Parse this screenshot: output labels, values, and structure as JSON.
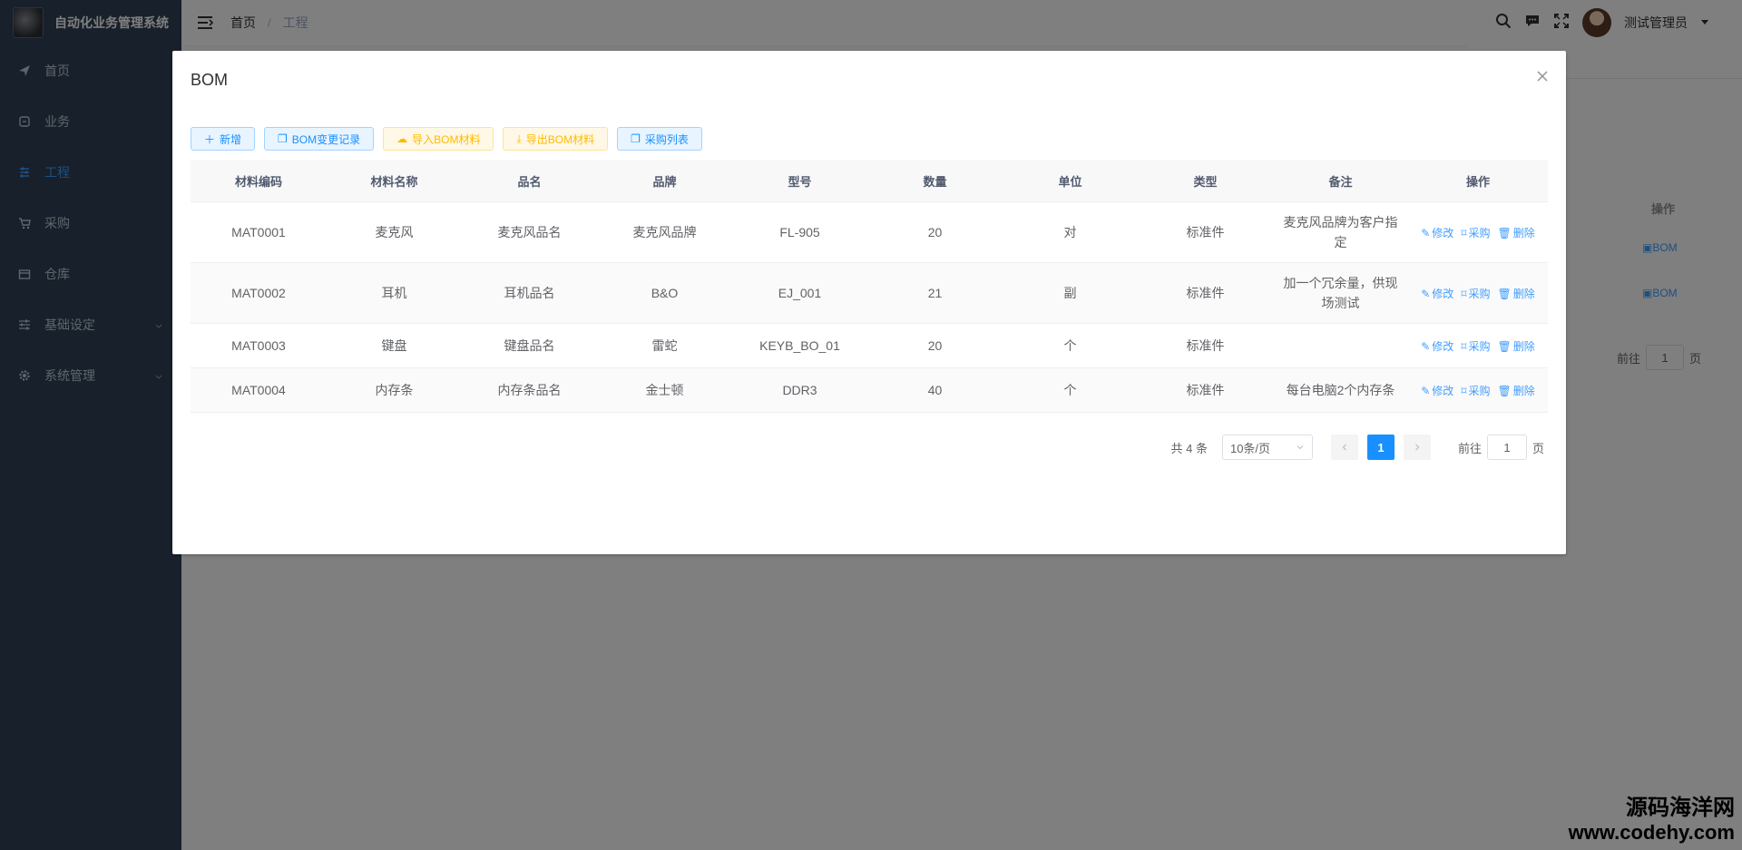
{
  "app": {
    "title": "自动化业务管理系统"
  },
  "sidebar": {
    "items": [
      {
        "label": "首页",
        "icon": "paper-plane-icon"
      },
      {
        "label": "业务",
        "icon": "business-icon"
      },
      {
        "label": "工程",
        "icon": "engineering-icon",
        "active": true
      },
      {
        "label": "采购",
        "icon": "cart-icon"
      },
      {
        "label": "仓库",
        "icon": "warehouse-icon"
      },
      {
        "label": "基础设定",
        "icon": "sliders-icon",
        "has_children": true
      },
      {
        "label": "系统管理",
        "icon": "gear-icon",
        "has_children": true
      }
    ]
  },
  "navbar": {
    "breadcrumb": [
      "首页",
      "工程"
    ],
    "user": {
      "name": "测试管理员"
    }
  },
  "background": {
    "table_header": "操作",
    "row_actions": [
      "BOM",
      "BOM"
    ],
    "pager": {
      "goto_label": "前往",
      "goto_value": "1",
      "page_suffix": "页"
    }
  },
  "dialog": {
    "title": "BOM",
    "toolbar": [
      {
        "label": "新增",
        "icon": "plus-icon",
        "style": "primary"
      },
      {
        "label": "BOM变更记录",
        "icon": "copy-icon",
        "style": "info"
      },
      {
        "label": "导入BOM材料",
        "icon": "upload-icon",
        "style": "warning"
      },
      {
        "label": "导出BOM材料",
        "icon": "download-icon",
        "style": "warning"
      },
      {
        "label": "采购列表",
        "icon": "copy-icon",
        "style": "blue-alt"
      }
    ],
    "table": {
      "columns": [
        "材料编码",
        "材料名称",
        "品名",
        "品牌",
        "型号",
        "数量",
        "单位",
        "类型",
        "备注",
        "操作"
      ],
      "rows": [
        {
          "code": "MAT0001",
          "name": "麦克风",
          "product": "麦克风品名",
          "brand": "麦克风品牌",
          "model": "FL-905",
          "qty": "20",
          "unit": "对",
          "type": "标准件",
          "note": "麦克风品牌为客户指定"
        },
        {
          "code": "MAT0002",
          "name": "耳机",
          "product": "耳机品名",
          "brand": "B&O",
          "model": "EJ_001",
          "qty": "21",
          "unit": "副",
          "type": "标准件",
          "note": "加一个冗余量，供现场测试"
        },
        {
          "code": "MAT0003",
          "name": "键盘",
          "product": "键盘品名",
          "brand": "雷蛇",
          "model": "KEYB_BO_01",
          "qty": "20",
          "unit": "个",
          "type": "标准件",
          "note": ""
        },
        {
          "code": "MAT0004",
          "name": "内存条",
          "product": "内存条品名",
          "brand": "金士顿",
          "model": "DDR3",
          "qty": "40",
          "unit": "个",
          "type": "标准件",
          "note": "每台电脑2个内存条"
        }
      ],
      "row_actions": [
        "修改",
        "采购",
        "删除"
      ]
    },
    "pagination": {
      "total": "共 4 条",
      "page_size": "10条/页",
      "current_page": "1",
      "goto_label": "前往",
      "goto_value": "1",
      "page_suffix": "页"
    }
  },
  "watermark": {
    "cn": "源码海洋网",
    "url": "www.codehy.com"
  },
  "colors": {
    "sidebar_bg": "#304156",
    "accent": "#409eff",
    "overlay": "rgba(0,0,0,0.5)"
  }
}
